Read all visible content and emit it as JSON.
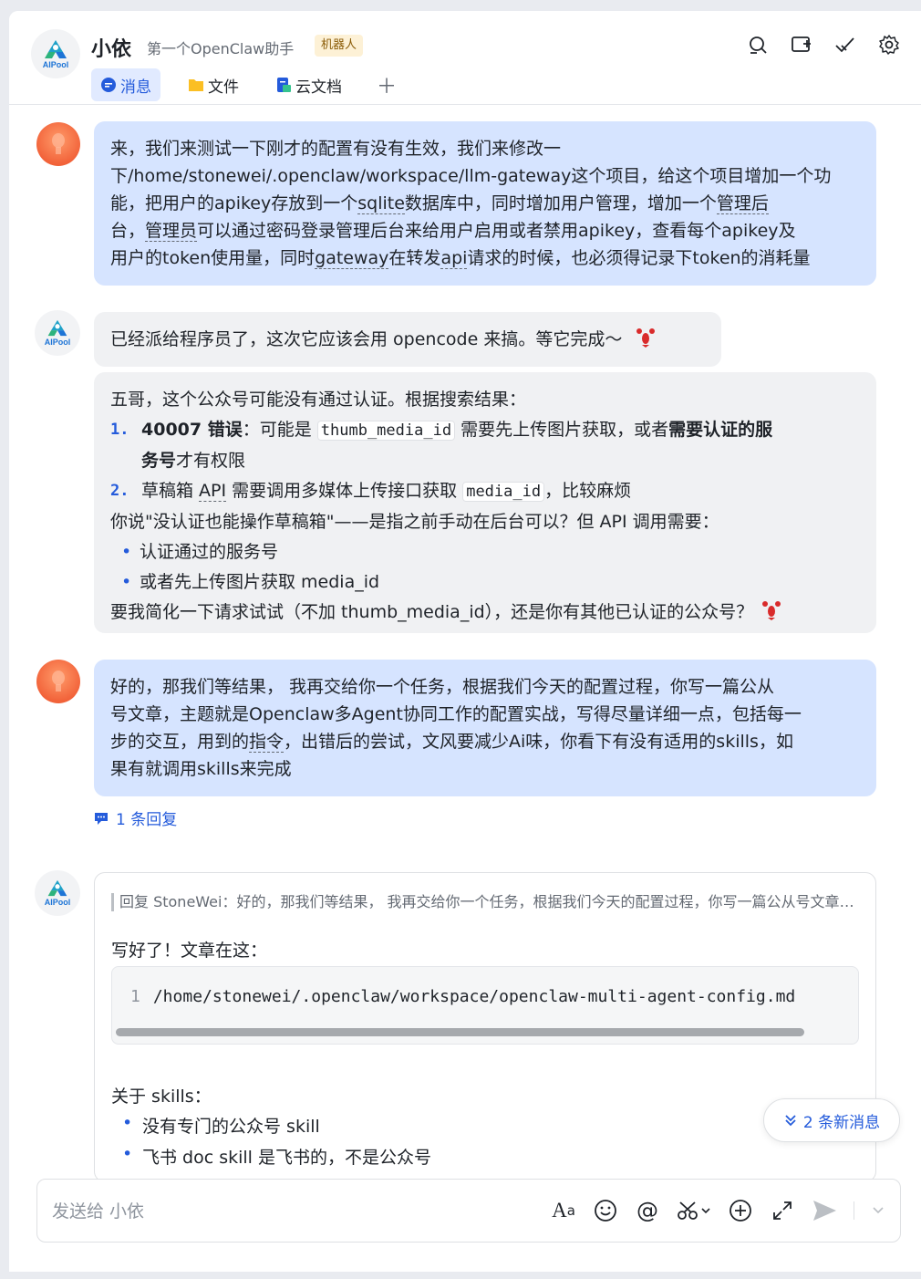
{
  "chat": {
    "title": "小依",
    "subtitle": "第一个OpenClaw助手",
    "badge": "机器人",
    "bot_brand": "AIPool"
  },
  "header_icons": [
    "search-icon",
    "add-member-icon",
    "check-icon",
    "settings-icon"
  ],
  "tabs": [
    {
      "label": "消息",
      "icon": "chat-bubble-icon",
      "active": true
    },
    {
      "label": "文件",
      "icon": "folder-icon",
      "active": false
    },
    {
      "label": "云文档",
      "icon": "cloud-doc-icon",
      "active": false
    }
  ],
  "messages": {
    "m1": {
      "l1": "来，我们来测试一下刚才的配置有没有生效，我们来修改一",
      "l2": "下/home/stonewei/.openclaw/workspace/llm-gateway这个项目，给这个项目增加一个功",
      "l3a": "能，把用户的apikey存放到一个",
      "l3b": "sqlite",
      "l3c": "数据库中，同时增加用户管理，增加一个",
      "l3d": "管理后",
      "l4a": "台，",
      "l4b": "管理员",
      "l4c": "可以通过密码登录管理后台来给用户启用或者禁用apikey，查看每个apikey及",
      "l5a": "用户的token使用量，同时",
      "l5b": "gateway",
      "l5c": "在转发",
      "l5d": "api",
      "l5e": "请求的时候，也必须得记录下token的消耗量"
    },
    "m2": {
      "text": "已经派给程序员了，这次它应该会用 opencode 来搞。等它完成～"
    },
    "m3": {
      "intro": "五哥，这个公众号可能没有通过认证。根据搜索结果：",
      "i1_num": "1.",
      "i1_bold": "40007 错误",
      "i1_a": "：可能是 ",
      "i1_code": "thumb_media_id",
      "i1_b": " 需要先上传图片获取，或者",
      "i1_bold2a": "需要认证的服",
      "i1_bold2b": "务号",
      "i1_c": "才有权限",
      "i2_num": "2.",
      "i2_a": "草稿箱 ",
      "i2_api": "API",
      "i2_b": " 需要调用多媒体上传接口获取 ",
      "i2_code": "media_id",
      "i2_c": "，比较麻烦",
      "q": "你说\"没认证也能操作草稿箱\"——是指之前手动在后台可以？但 API 调用需要：",
      "b1": "认证通过的服务号",
      "b2": "或者先上传图片获取 media_id",
      "end": "要我简化一下请求试试（不加 thumb_media_id），还是你有其他已认证的公众号？"
    },
    "m4": {
      "l1": "好的，那我们等结果， 我再交给你一个任务，根据我们今天的配置过程，你写一篇公从",
      "l2": "号文章，主题就是Openclaw多Agent协同工作的配置实战，写得尽量详细一点，包括每一",
      "l3a": "步的交互，用到的",
      "l3b": "指令",
      "l3c": "，出错后的尝试，文风要减少Ai味，你看下有没有适用的skills，如",
      "l4": "果有就调用skills来完成"
    },
    "thread_reply": "1 条回复",
    "m5": {
      "quote": "回复 StoneWei：好的，那我们等结果， 我再交给你一个任务，根据我们今天的配置过程，你写一篇公从号文章，主题就是Openclaw多Agent协同工作的配置实战",
      "done": "写好了！文章在这：",
      "code_line_no": "1",
      "code_line": "/home/stonewei/.openclaw/workspace/openclaw-multi-agent-config.md",
      "skills_title": "关于 skills：",
      "s1": "没有专门的公众号 skill",
      "s2": "飞书 doc skill 是飞书的，不是公众号"
    }
  },
  "new_messages": "2 条新消息",
  "composer": {
    "placeholder": "发送给 小依",
    "value": ""
  },
  "composer_icons": [
    "text-format-icon",
    "emoji-icon",
    "mention-icon",
    "screenshot-icon",
    "plus-circle-icon",
    "expand-icon",
    "send-icon",
    "chevron-down-icon"
  ],
  "colors": {
    "accent": "#245bdb",
    "user_bubble": "#d6e4ff",
    "bot_bubble": "#f0f1f3",
    "badge_bg": "#fdf1d6"
  }
}
